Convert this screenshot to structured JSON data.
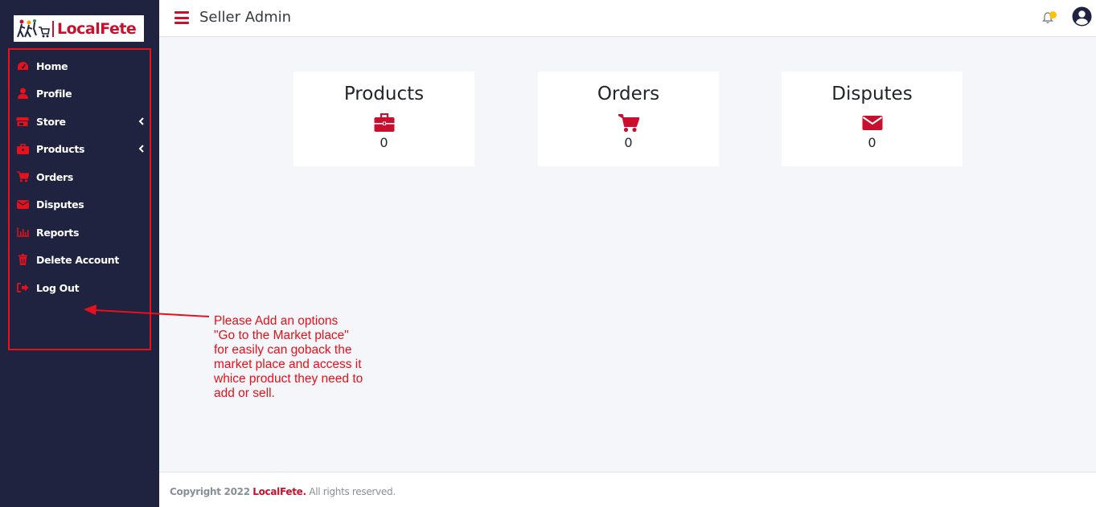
{
  "brand": {
    "logo_text": "LocalFete",
    "accent": "#c8102e"
  },
  "sidebar": {
    "items": [
      {
        "label": "Home",
        "icon": "dashboard-icon"
      },
      {
        "label": "Profile",
        "icon": "user-icon"
      },
      {
        "label": "Store",
        "icon": "store-icon",
        "has_submenu": true
      },
      {
        "label": "Products",
        "icon": "briefcase-icon",
        "has_submenu": true
      },
      {
        "label": "Orders",
        "icon": "cart-icon"
      },
      {
        "label": "Disputes",
        "icon": "envelope-icon"
      },
      {
        "label": "Reports",
        "icon": "chart-icon"
      },
      {
        "label": "Delete Account",
        "icon": "trash-icon"
      },
      {
        "label": "Log Out",
        "icon": "logout-icon"
      }
    ]
  },
  "header": {
    "title": "Seller Admin",
    "notification_icon": "bell-icon",
    "user_icon": "user-circle-icon"
  },
  "cards": [
    {
      "title": "Products",
      "value": "0",
      "icon": "briefcase-icon"
    },
    {
      "title": "Orders",
      "value": "0",
      "icon": "cart-icon"
    },
    {
      "title": "Disputes",
      "value": "0",
      "icon": "envelope-icon"
    }
  ],
  "annotation": {
    "lines": [
      "Please Add an options",
      "\"Go to the Market place\"",
      "for easily can goback the",
      "market place and access it",
      "whice product they need to",
      "add or sell."
    ],
    "color": "#e8101a"
  },
  "footer": {
    "prefix": "Copyright 2022",
    "brand": "LocalFete.",
    "suffix": "All rights reserved."
  }
}
